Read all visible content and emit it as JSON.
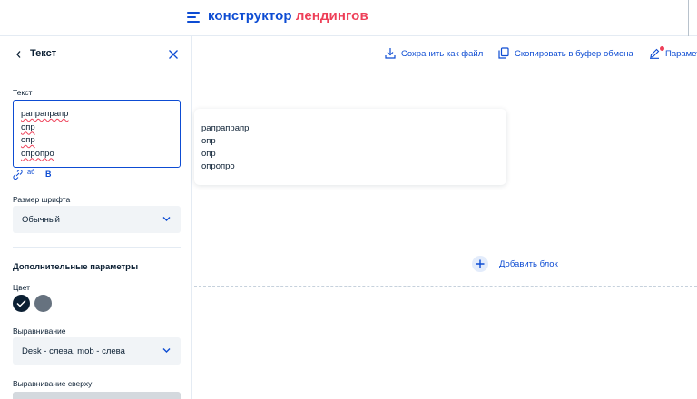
{
  "header": {
    "brand_part1": "конструктор",
    "brand_part2": "лендингов"
  },
  "panel": {
    "title": "Текст",
    "text_label": "Текст",
    "text_lines": [
      "рапрапрапр",
      "опр",
      "опр",
      "опропро"
    ],
    "format_bold": "B",
    "format_ab": "аб",
    "font_size_label": "Размер шрифта",
    "font_size_value": "Обычный",
    "extra_params_title": "Дополнительные параметры",
    "color_label": "Цвет",
    "colors": [
      "#0b1f33",
      "#66727f"
    ],
    "align_label": "Выравнивание",
    "align_value": "Desk - слева, mob - слева",
    "align_top_label": "Выравнивание сверху"
  },
  "toolbar": {
    "save_file": "Сохранить как файл",
    "copy_clipboard": "Скопировать в буфер обмена",
    "params": "Парамет"
  },
  "canvas": {
    "card_lines": [
      "рапрапрапр",
      "опр",
      "опр",
      "опропро"
    ],
    "add_block": "Добавить блок"
  },
  "colors": {
    "accent": "#0d4cd3",
    "brand_red": "#ee3f58",
    "text": "#0b1f33"
  }
}
